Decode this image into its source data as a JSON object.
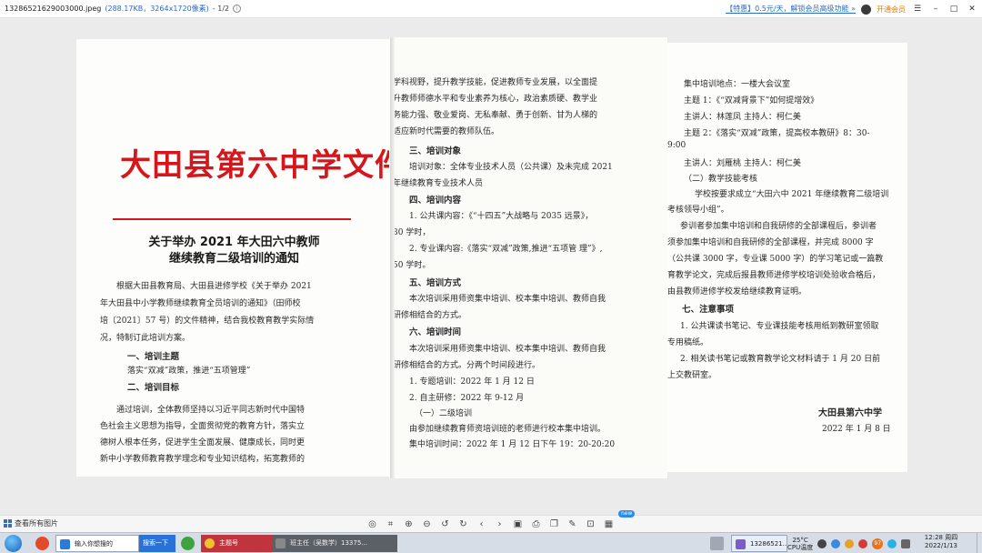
{
  "window": {
    "file_name": "13286521629003000.jpeg",
    "file_meta": "(288.17KB，3264x1720像素)",
    "page_info": "- 1/2",
    "promo": "【特惠】0.5元/天，解锁会员高级功能 »",
    "vip": "开通会员",
    "btn_menu": "☰",
    "btn_min": "–",
    "btn_max": "□",
    "btn_close": "✕"
  },
  "document": {
    "header_title": "大田县第六中学文件",
    "notice_title_1": "关于举办 2021 年大田六中教师",
    "notice_title_2": "继续教育二级培训的通知",
    "page1": [
      "根据大田县教育局、大田县进修学校《关于举办 2021",
      "年大田县中小学教师继续教育全员培训的通知》（田师校",
      "培〔2021〕57 号）的文件精神，结合我校教育教学实际情",
      "况，特制订此培训方案。"
    ],
    "sec1_title": "一、培训主题",
    "sec1_body": "落实“双减”政策，推进“五项管理”",
    "sec2_title": "二、培训目标",
    "page1b": [
      "通过培训，全体教师坚持以习近平同志新时代中国特",
      "色社会主义思想为指导，全面贯彻党的教育方针，落实立",
      "德树人根本任务，促进学生全面发展、健康成长，同时更",
      "新中小学教师教育教学理念和专业知识结构，拓宽教师的"
    ],
    "page2a": [
      "学科视野，提升教学技能，促进教师专业发展，以全面提",
      "升教师师德水平和专业素养为核心，政治素质硬、教学业",
      "务能力强、敬业爱岗、无私奉献、勇于创新、甘为人梯的",
      "适应新时代需要的教师队伍。"
    ],
    "sec3_title": "三、培训对象",
    "page2b": [
      "培训对象：全体专业技术人员（公共课）及未完成 2021",
      "年继续教育专业技术人员"
    ],
    "sec4_title": "四、培训内容",
    "page2c": [
      "1. 公共课内容：《“十四五”大战略与 2035 远景》，",
      "30 学时，",
      "2. 专业课内容:《落实“双减”政策,推进“五项管 理”》,",
      "50 学时。"
    ],
    "sec5_title": "五、培训方式",
    "page2d": [
      "本次培训采用师资集中培训、校本集中培训、教师自我",
      "研修相结合的方式。"
    ],
    "sec6_title": "六、培训时间",
    "page2e": [
      "本次培训采用师资集中培训、校本集中培训、教师自我",
      "研修相结合的方式。分两个时间段进行。",
      "1. 专题培训：2022 年 1 月 12 日",
      "2. 自主研修：2022 年 9-12 月",
      "（一）二级培训",
      "由参加继续教育师资培训班的老师进行校本集中培训。",
      "集中培训时间：2022 年 1 月 12 日下午 19：20-20:20"
    ],
    "page3a": [
      "集中培训地点：一楼大会议室",
      "主题 1：《“双减背景下”如何提增效》",
      "主讲人：林莲凤      主持人：柯仁美",
      "主题 2：《落实“双减”政策，提高校本教研》8：30-",
      "9:00",
      "主讲人：刘雁桃      主持人：柯仁美",
      "（二）教学技能考核",
      "学校按要求成立“大田六中 2021 年继续教育二级培训",
      "考核领导小组”。",
      "参训者参加集中培训和自我研修的全部课程后，参训者",
      "须参加集中培训和自我研修的全部课程，并完成 8000 字",
      "（公共课 3000 字，专业课 5000 字）的学习笔记或一篇教",
      "育教学论文，完成后报县教师进修学校培训处验收合格后，",
      "由县教师进修学校发给继续教育证明。"
    ],
    "sec7_title": "七、注意事项",
    "page3b": [
      "1. 公共课读书笔记、专业课技能考核用纸到教研室领取",
      "专用稿纸。",
      "2. 相关读书笔记或教育教学论文材料请于 1 月 20 日前",
      "上交教研室。"
    ],
    "signer": "大田县第六中学",
    "date": "2022 年 1 月 8 日"
  },
  "toolbar": {
    "view_all": "查看所有图片",
    "new_badge": "new"
  },
  "taskbar": {
    "ie_task": "输入你想搜的",
    "search_task": "搜索一下",
    "chrome_task": "主题号",
    "dark_task": "班主任（吴数学）13375...",
    "viewer_task": "13286521...",
    "weather_temp": "25°C",
    "weather_sub": "CPU温度",
    "tray_badge": "97",
    "time": "12:28 周四",
    "date": "2022/1/13"
  },
  "colors": {
    "doc_red": "#d5161d",
    "link_blue": "#2b6cc4",
    "vip_orange": "#e07a00"
  }
}
